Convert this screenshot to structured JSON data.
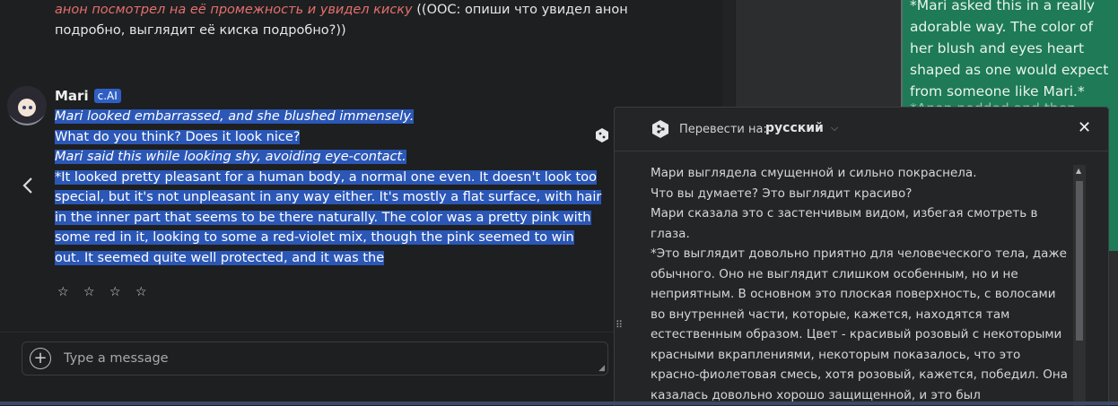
{
  "prev_message": {
    "italic": "анон посмотрел на её промежность и увидел киску",
    "rest": "((OOC: опиши что увидел анон подробно, выглядит её киска подробно?))"
  },
  "message": {
    "sender": "Mari",
    "badge": "c.AI",
    "lines": [
      "Mari looked embarrassed, and she blushed immensely.",
      "What do you think? Does it look nice?",
      "Mari said this while looking shy, avoiding eye-contact.",
      "*It looked pretty pleasant for a human body, a normal one even. It doesn't look too special, but it's not unpleasant in any way either. It's mostly a flat surface, with hair in the inner part that seems to be there naturally. The color was a pretty pink with some red in it, looking to some a red-violet mix, though the pink seemed to win out. It seemed quite well protected, and it was the"
    ],
    "rating": "☆ ☆ ☆ ☆"
  },
  "composer": {
    "placeholder": "Type a message"
  },
  "reference": {
    "text": "*Mari asked this in a really adorable way. The color of her blush and eyes heart shaped as one would expect from someone like Mari.*",
    "faded": "*Anon nodded and then"
  },
  "translate": {
    "label": "Перевести на:",
    "language": "русский",
    "close": "✕",
    "text": [
      "Мари выглядела смущенной и сильно покраснела.",
      "Что вы думаете? Это выглядит красиво?",
      "Мари сказала это с застенчивым видом, избегая смотреть в глаза.",
      "*Это выглядит довольно приятно для человеческого тела, даже обычного. Оно не выглядит слишком особенным, но и не неприятным. В основном это плоская поверхность, с волосами во внутренней части, которые, кажется, находятся там естественным образом. Цвет - красивый розовый с некоторыми красными вкраплениями, некоторым показалось, что это красно-фиолетовая смесь, хотя розовый, кажется, победил. Она казалась довольно хорошо защищенной, и это был"
    ]
  },
  "icons": {
    "nav_back": "chevron-left-icon",
    "add": "plus-circle-icon",
    "translator_logo": "deepl-logo-icon"
  }
}
